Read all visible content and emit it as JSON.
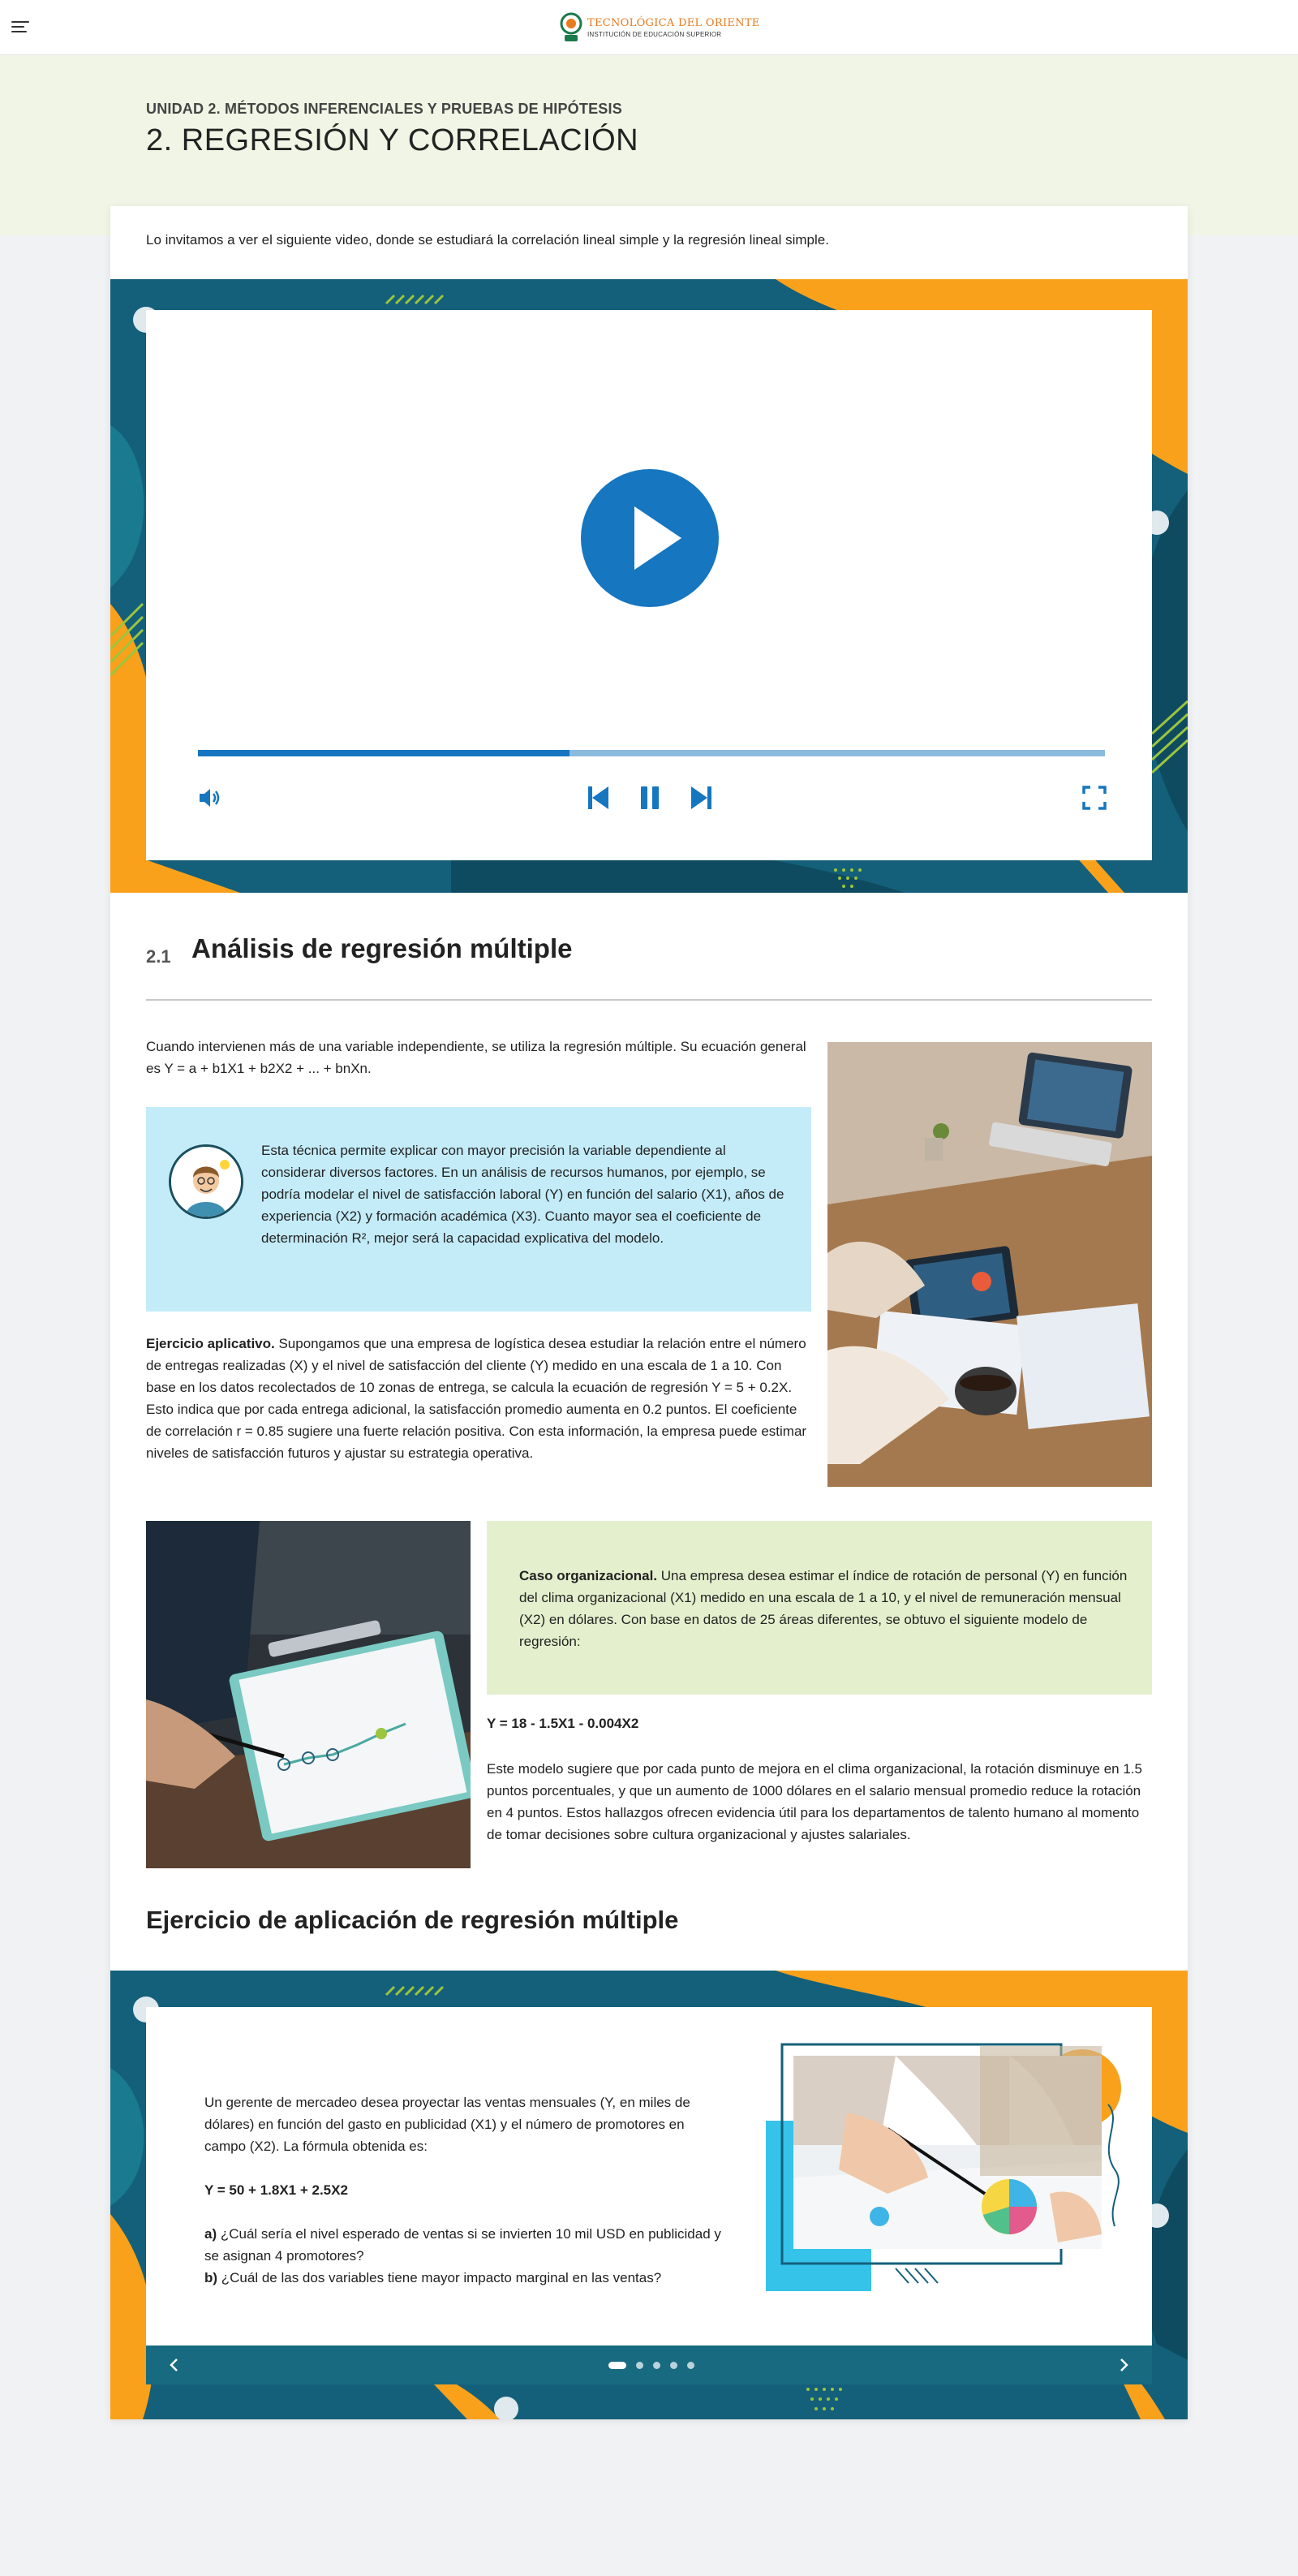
{
  "header": {
    "logo_name": "TECNOLÓGICA DEL ORIENTE",
    "logo_sub": "INSTITUCIÓN DE EDUCACIÓN SUPERIOR",
    "unit": "UNIDAD 2. MÉTODOS INFERENCIALES Y PRUEBAS DE HIPÓTESIS",
    "title": "2. REGRESIÓN Y CORRELACIÓN"
  },
  "intro": "Lo invitamos a ver el siguiente video, donde se estudiará la correlación lineal simple y la regresión lineal simple.",
  "video": {
    "progress_fraction": 0.41,
    "controls": [
      "volume-icon",
      "previous-icon",
      "pause-icon",
      "next-icon",
      "fullscreen-icon"
    ]
  },
  "section": {
    "number": "2.1",
    "title": "Análisis de regresión múltiple",
    "p1": "Cuando intervienen más de una variable independiente, se utiliza la regresión múltiple. Su ecuación general es Y = a + b1X1 + b2X2 + ... + bnXn.",
    "info": "Esta técnica permite explicar con mayor precisión la variable dependiente al considerar diversos factores. En un análisis de recursos humanos, por ejemplo, se podría modelar el nivel de satisfacción laboral (Y) en función del salario (X1), años de experiencia (X2) y formación académica (X3). Cuanto mayor sea el coeficiente de determinación R², mejor será la capacidad explicativa del modelo.",
    "exercise_label": "Ejercicio aplicativo.",
    "exercise_text": " Supongamos que una empresa de logística desea estudiar la relación entre el número de entregas realizadas (X) y el nivel de satisfacción del cliente (Y) medido en una escala de 1 a 10. Con base en los datos recolectados de 10 zonas de entrega, se calcula la ecuación de regresión Y = 5 + 0.2X. Esto indica que por cada entrega adicional, la satisfacción promedio aumenta en 0.2 puntos. El coeficiente de correlación r = 0.85 sugiere una fuerte relación positiva. Con esta información, la empresa puede estimar niveles de satisfacción futuros y ajustar su estrategia operativa.",
    "case_label": "Caso organizacional.",
    "case_text": " Una empresa desea estimar el índice de rotación de personal (Y) en función del clima organizacional (X1) medido en una escala de 1 a 10, y el nivel de remuneración mensual (X2) en dólares. Con base en datos de 25 áreas diferentes, se obtuvo el siguiente modelo de regresión:",
    "case_formula": "Y = 18 - 1.5X1 - 0.004X2",
    "case_conclusion": "Este modelo sugiere que por cada punto de mejora en el clima organizacional, la rotación disminuye en 1.5 puntos porcentuales, y que un aumento de 1000 dólares en el salario mensual promedio reduce la rotación en 4 puntos. Estos hallazgos ofrecen evidencia útil para los departamentos de talento humano al momento de tomar decisiones sobre cultura organizacional y ajustes salariales."
  },
  "exercise": {
    "heading": "Ejercicio de aplicación de regresión múltiple",
    "slide_text": "Un gerente de mercadeo desea proyectar las ventas mensuales (Y, en miles de dólares) en función del gasto en publicidad (X1) y el número de promotores en campo (X2). La fórmula obtenida es:",
    "slide_formula": "Y = 50 + 1.8X1 + 2.5X2",
    "q1_label": "a)",
    "q1_text": " ¿Cuál sería el nivel esperado de ventas si se invierten 10 mil USD en publicidad y se asignan 4 promotores?",
    "q2_label": "b)",
    "q2_text": " ¿Cuál de las dos variables tiene mayor impacto marginal en las ventas?",
    "slides_count": 5,
    "active_slide": 1
  },
  "colors": {
    "primary_blue": "#1676c0",
    "teal": "#14607a",
    "orange": "#f9a11b",
    "info_bg": "#c4ecf8",
    "case_bg": "#e4f0cd",
    "header_bg": "#f1f5e5"
  }
}
